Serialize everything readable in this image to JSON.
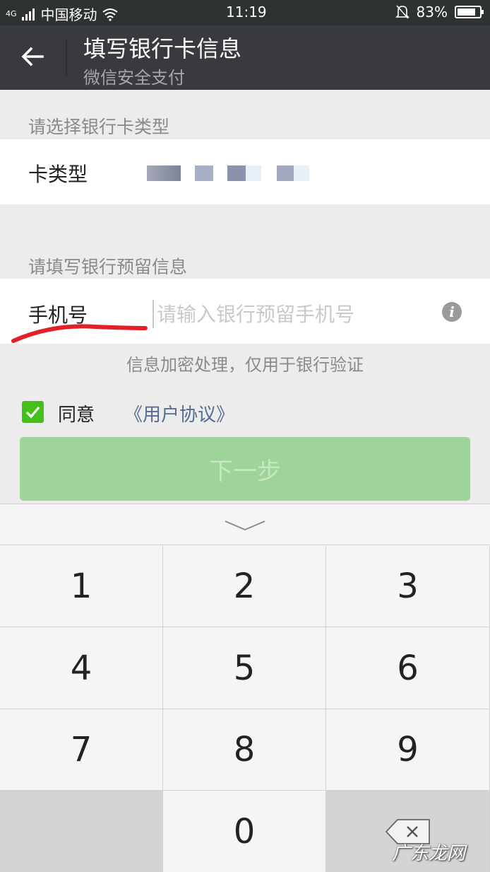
{
  "status_bar": {
    "network": "4G",
    "carrier": "中国移动",
    "time": "11:19",
    "battery": "83%",
    "battery_level": 0.83
  },
  "header": {
    "title": "填写银行卡信息",
    "subtitle": "微信安全支付"
  },
  "card_section": {
    "label": "请选择银行卡类型",
    "row_label": "卡类型"
  },
  "phone_section": {
    "label": "请填写银行预留信息",
    "row_label": "手机号",
    "placeholder": "请输入银行预留手机号",
    "hint": "信息加密处理，仅用于银行验证"
  },
  "agreement": {
    "agree_label": "同意",
    "protocol_link": "《用户协议》",
    "checked": true
  },
  "next_button": "下一步",
  "keypad": {
    "keys": [
      "1",
      "2",
      "3",
      "4",
      "5",
      "6",
      "7",
      "8",
      "9",
      "",
      "0",
      ""
    ]
  },
  "watermark": "广东龙网",
  "colors": {
    "header_bg": "#393a3f",
    "accent_green": "#45c01a",
    "button_disabled": "#9ed39a",
    "link_blue": "#576b95",
    "annotation_red": "#e3202a"
  },
  "icons": [
    "signal-icon",
    "wifi-icon",
    "mute-bell-icon",
    "battery-icon",
    "back-arrow-icon",
    "info-icon",
    "checkmark-icon",
    "collapse-chevron-icon",
    "backspace-icon"
  ]
}
